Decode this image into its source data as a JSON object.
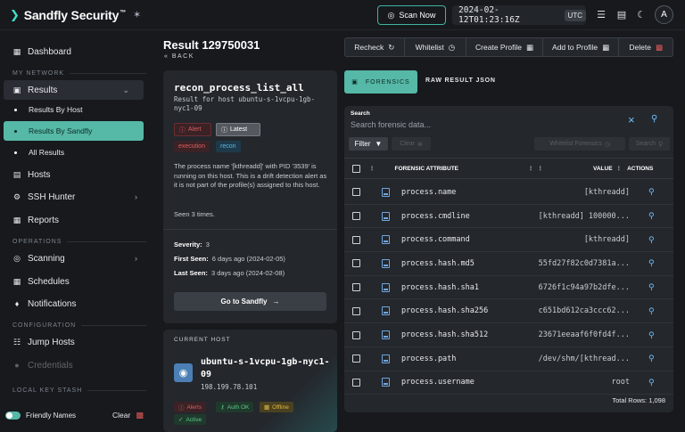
{
  "app": {
    "logo_text": "Sandfly Security",
    "logo_tm": "™",
    "scan_now_label": "Scan Now",
    "datetime": "2024-02-12T01:23:16Z",
    "timezone": "UTC",
    "avatar_initial": "A"
  },
  "sidebar": {
    "dashboard": "Dashboard",
    "section_network": "MY NETWORK",
    "results": "Results",
    "results_by_host": "Results By Host",
    "results_by_sandfly": "Results By Sandfly",
    "all_results": "All Results",
    "hosts": "Hosts",
    "ssh_hunter": "SSH Hunter",
    "reports": "Reports",
    "section_operations": "OPERATIONS",
    "scanning": "Scanning",
    "schedules": "Schedules",
    "notifications": "Notifications",
    "section_configuration": "CONFIGURATION",
    "jump_hosts": "Jump Hosts",
    "credentials": "Credentials",
    "section_stash": "LOCAL KEY STASH",
    "friendly_names": "Friendly Names",
    "clear": "Clear"
  },
  "result": {
    "title": "Result 129750031",
    "back": "BACK",
    "check_name": "recon_process_list_all",
    "check_host": "Result for host ubuntu-s-1vcpu-1gb-nyc1-09",
    "badge_alert": "Alert",
    "badge_latest": "Latest",
    "tag_execution": "execution",
    "tag_recon": "recon",
    "alert_text": "The process name '[kthreadd]' with PID '3539' is running on this host. This is a drift detection alert as it is not part of the profile(s) assigned to this host.",
    "seen": "Seen 3 times.",
    "severity_label": "Severity:",
    "severity_value": "3",
    "first_seen_label": "First Seen:",
    "first_seen_value": "6 days ago (2024-02-05)",
    "last_seen_label": "Last Seen:",
    "last_seen_value": "3 days ago (2024-02-08)",
    "goto_label": "Go to Sandfly"
  },
  "host": {
    "section_label": "CURRENT HOST",
    "name": "ubuntu-s-1vcpu-1gb-nyc1-09",
    "ip": "198.199.78.101",
    "badge_alerts": "Alerts",
    "badge_auth": "Auth OK",
    "badge_offline": "Offline",
    "badge_active": "Active"
  },
  "actions": {
    "recheck": "Recheck",
    "whitelist": "Whitelist",
    "create_profile": "Create Profile",
    "add_to_profile": "Add to Profile",
    "delete": "Delete"
  },
  "tabs": {
    "forensics": "FORENSICS",
    "raw": "RAW RESULT JSON"
  },
  "table": {
    "search_label": "Search",
    "search_placeholder": "Search forensic data...",
    "filter": "Filter",
    "clear": "Clear",
    "whitelist_forensics": "Whitelist Forensics",
    "search_btn": "Search",
    "col_attribute": "FORENSIC ATTRIBUTE",
    "col_value": "VALUE",
    "col_actions": "ACTIONS",
    "rows": [
      {
        "attr": "process.name",
        "value": "[kthreadd]"
      },
      {
        "attr": "process.cmdline",
        "value": "[kthreadd] 100000..."
      },
      {
        "attr": "process.command",
        "value": "[kthreadd]"
      },
      {
        "attr": "process.hash.md5",
        "value": "55fd27f82c0d7381a..."
      },
      {
        "attr": "process.hash.sha1",
        "value": "6726f1c94a97b2dfe..."
      },
      {
        "attr": "process.hash.sha256",
        "value": "c651bd612ca3ccc62..."
      },
      {
        "attr": "process.hash.sha512",
        "value": "23671eeaaf6f0fd4f..."
      },
      {
        "attr": "process.path",
        "value": "/dev/shm/[kthread..."
      },
      {
        "attr": "process.username",
        "value": "root"
      }
    ],
    "total_rows": "Total Rows: 1,098"
  },
  "colors": {
    "accent": "#56b8a6",
    "alert": "#e35c5c",
    "link": "#6fc0ff"
  }
}
